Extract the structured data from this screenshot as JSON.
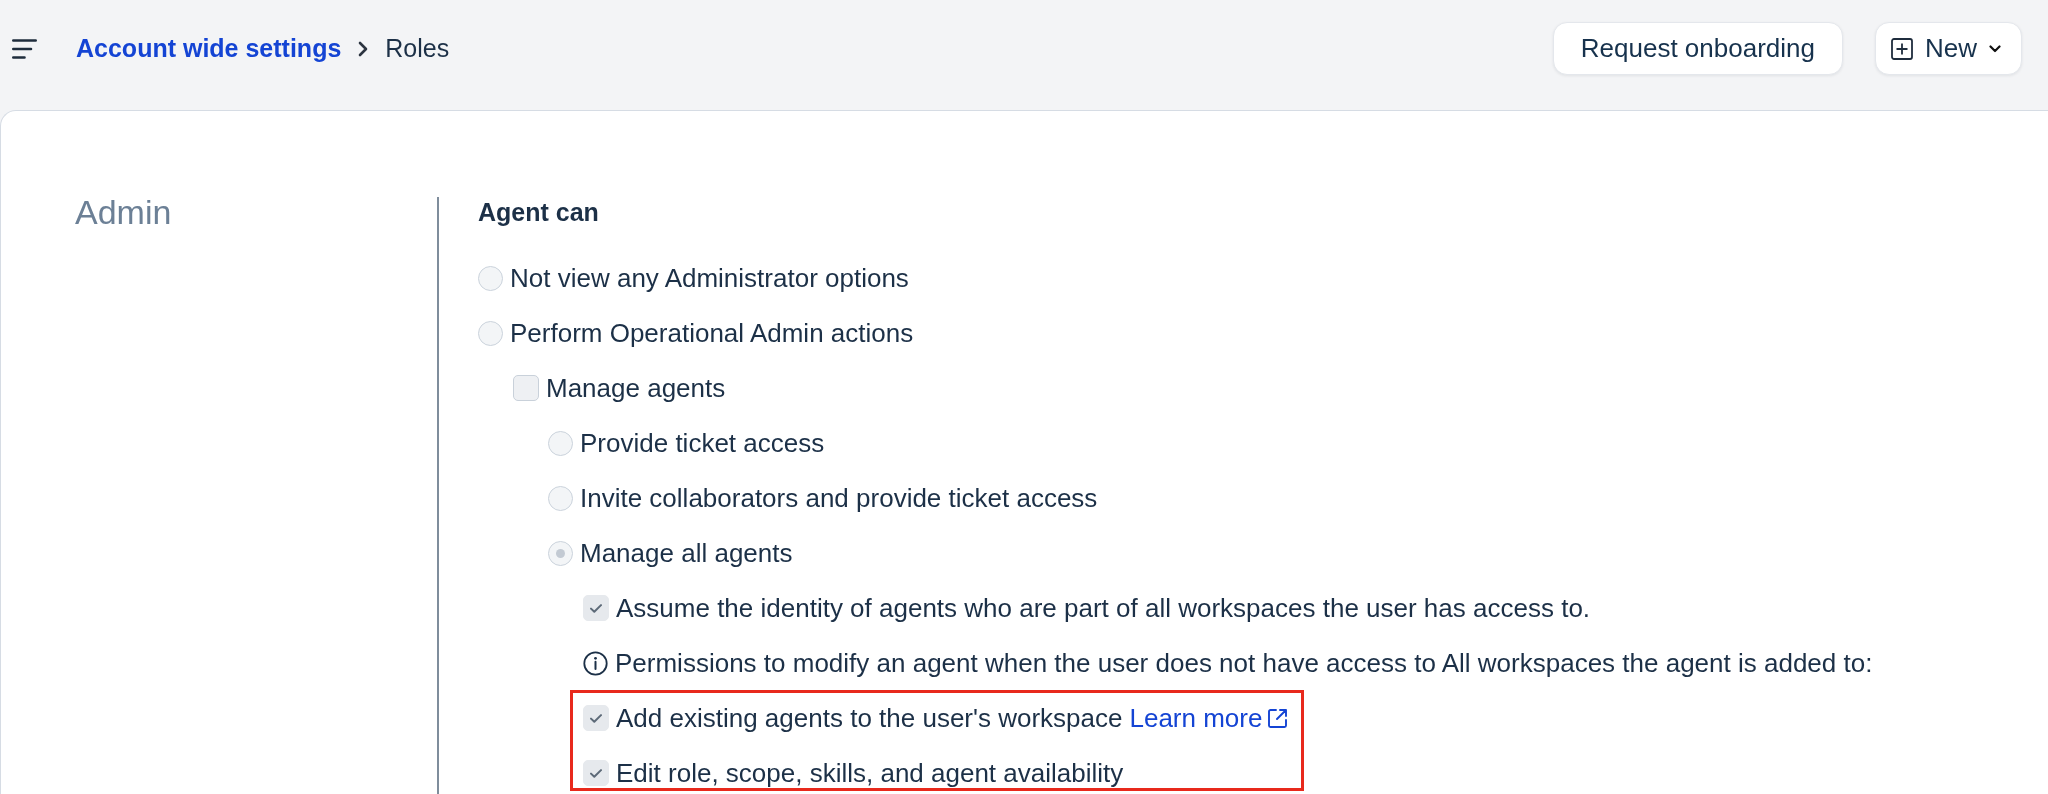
{
  "topbar": {
    "breadcrumb": [
      {
        "kind": "link",
        "label": "Account wide settings"
      },
      {
        "kind": "current",
        "label": "Roles"
      }
    ],
    "buttons": [
      {
        "kind": "plain",
        "label": "Request onboarding"
      },
      {
        "kind": "new",
        "label": "New"
      }
    ]
  },
  "section": {
    "title": "Admin",
    "heading": "Agent can",
    "options": [
      {
        "kind": "radio",
        "label": "Not view any Administrator options",
        "selected": false
      },
      {
        "kind": "radio",
        "label": "Perform Operational Admin actions",
        "selected": false,
        "children": [
          {
            "kind": "checkbox",
            "label": "Manage agents",
            "checked": false,
            "children": [
              {
                "kind": "radio",
                "label": "Provide ticket access",
                "selected": false
              },
              {
                "kind": "radio",
                "label": "Invite collaborators and provide ticket access",
                "selected": false
              },
              {
                "kind": "radio",
                "label": "Manage all agents",
                "selected": true,
                "children": [
                  {
                    "kind": "checkbox",
                    "label": "Assume the identity of agents who are part of all workspaces the user has access to.",
                    "checked": true
                  },
                  {
                    "kind": "info",
                    "label": "Permissions to modify an agent when the user does not have access to All workspaces the agent is added to:"
                  },
                  {
                    "kind": "highlight",
                    "children": [
                      {
                        "kind": "checkbox",
                        "label": "Add existing agents to the user's workspace",
                        "checked": true,
                        "link": "Learn more"
                      },
                      {
                        "kind": "checkbox",
                        "label": "Edit role, scope, skills, and agent availability",
                        "checked": true
                      }
                    ]
                  }
                ]
              }
            ]
          }
        ]
      }
    ]
  }
}
